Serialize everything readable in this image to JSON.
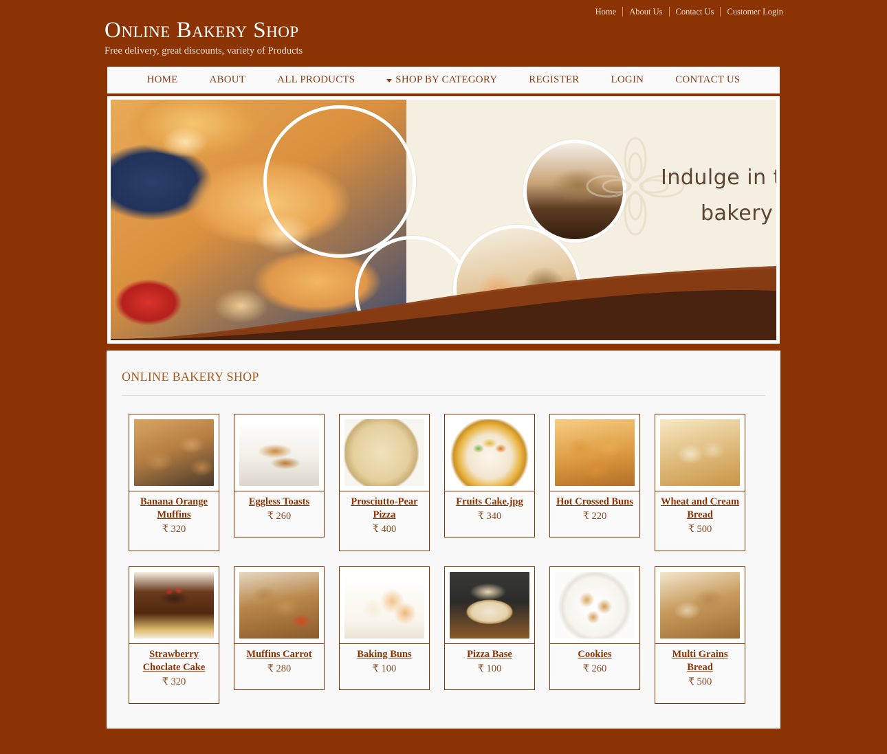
{
  "topbar": {
    "links": [
      "Home",
      "About Us",
      "Contact Us",
      "Customer Login"
    ]
  },
  "brand": {
    "title": "Online Bakery Shop",
    "tagline": "Free delivery, great discounts, variety of Products"
  },
  "nav": {
    "items": [
      {
        "label": "HOME",
        "caret": false
      },
      {
        "label": "ABOUT",
        "caret": false
      },
      {
        "label": "ALL PRODUCTS",
        "caret": false
      },
      {
        "label": "SHOP BY CATEGORY",
        "caret": true
      },
      {
        "label": "REGISTER",
        "caret": false
      },
      {
        "label": "LOGIN",
        "caret": false
      },
      {
        "label": "CONTACT US",
        "caret": false
      }
    ]
  },
  "banner": {
    "caption_line1": "Indulge in t",
    "caption_line2": "bakery"
  },
  "panel": {
    "title": "ONLINE BAKERY SHOP",
    "currency": "₹",
    "rows": [
      [
        {
          "name": "Banana Orange Muffins",
          "price": "₹ 320",
          "thumb": "muffins-banana-orange"
        },
        {
          "name": "Eggless Toasts",
          "price": "₹ 260",
          "thumb": "eggless-toasts"
        },
        {
          "name": "Prosciutto-Pear Pizza",
          "price": "₹ 400",
          "thumb": "prosciutto-pear-pizza"
        },
        {
          "name": "Fruits Cake.jpg",
          "price": "₹ 340",
          "thumb": "fruits-cake"
        },
        {
          "name": "Hot Crossed Buns",
          "price": "₹ 220",
          "thumb": "hot-crossed-buns"
        },
        {
          "name": "Wheat and Cream Bread",
          "price": "₹ 500",
          "thumb": "wheat-cream-bread"
        }
      ],
      [
        {
          "name": "Strawberry Choclate Cake",
          "price": "₹ 320",
          "thumb": "strawberry-chocolate-cake"
        },
        {
          "name": "Muffins Carrot",
          "price": "₹ 280",
          "thumb": "muffins-carrot"
        },
        {
          "name": "Baking Buns",
          "price": "₹ 100",
          "thumb": "baking-buns"
        },
        {
          "name": "Pizza Base",
          "price": "₹ 100",
          "thumb": "pizza-base"
        },
        {
          "name": "Cookies",
          "price": "₹ 260",
          "thumb": "cookies"
        },
        {
          "name": "Multi Grains Bread",
          "price": "₹ 500",
          "thumb": "multi-grains-bread"
        }
      ]
    ]
  },
  "colors": {
    "page_background": "#8c3304",
    "accent": "#8c3304",
    "panel_background": "#f8f8f8",
    "heading": "#a8591c",
    "nav_text": "#8f3b14"
  }
}
